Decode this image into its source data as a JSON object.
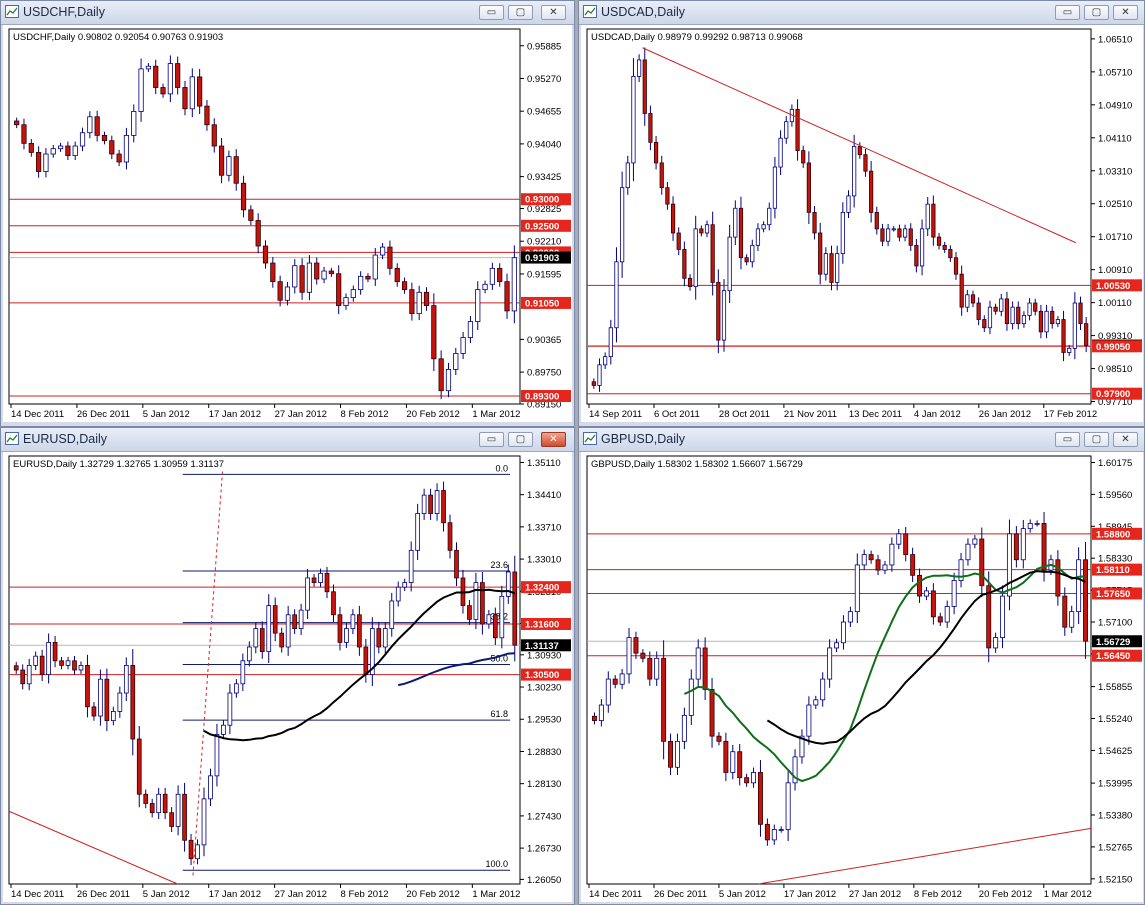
{
  "windows": [
    {
      "id": "usdchf",
      "title": "USDCHF,Daily",
      "header": "USDCHF,Daily  0.90802 0.92054 0.90763 0.91903",
      "chart_data": {
        "type": "candlestick",
        "symbol": "USDCHF",
        "timeframe": "Daily",
        "ohlc_last": {
          "open": 0.90802,
          "high": 0.92054,
          "low": 0.90763,
          "close": 0.91903
        },
        "y_ticks": [
          "0.95885",
          "0.95270",
          "0.94655",
          "0.94040",
          "0.93425",
          "0.92825",
          "0.92210",
          "0.91595",
          "0.90365",
          "0.89750",
          "0.89150"
        ],
        "ylim": [
          0.8915,
          0.962
        ],
        "x_ticks": [
          "14 Dec 2011",
          "26 Dec 2011",
          "5 Jan 2012",
          "17 Jan 2012",
          "27 Jan 2012",
          "8 Feb 2012",
          "20 Feb 2012",
          "1 Mar 2012"
        ],
        "price_labels": [
          {
            "value": 0.93,
            "text": "0.93000",
            "bg": "#e5261c"
          },
          {
            "value": 0.925,
            "text": "0.92500",
            "bg": "#e5261c"
          },
          {
            "value": 0.92,
            "text": "0.92000",
            "bg": "#e5261c"
          },
          {
            "value": 0.91903,
            "text": "0.91903",
            "bg": "#000000"
          },
          {
            "value": 0.9105,
            "text": "0.91050",
            "bg": "#e5261c"
          },
          {
            "value": 0.893,
            "text": "0.89300",
            "bg": "#e5261c"
          }
        ],
        "closes": [
          0.944,
          0.9405,
          0.9388,
          0.9352,
          0.9385,
          0.9395,
          0.94,
          0.9382,
          0.94,
          0.9425,
          0.9455,
          0.942,
          0.941,
          0.9385,
          0.937,
          0.942,
          0.9465,
          0.9545,
          0.955,
          0.951,
          0.9498,
          0.9555,
          0.951,
          0.947,
          0.953,
          0.9475,
          0.944,
          0.94,
          0.9345,
          0.938,
          0.933,
          0.928,
          0.926,
          0.9212,
          0.918,
          0.9145,
          0.911,
          0.9135,
          0.9175,
          0.9125,
          0.918,
          0.915,
          0.9165,
          0.916,
          0.91,
          0.9115,
          0.913,
          0.9155,
          0.915,
          0.9195,
          0.921,
          0.917,
          0.9145,
          0.913,
          0.9085,
          0.9125,
          0.91,
          0.9,
          0.894,
          0.898,
          0.901,
          0.904,
          0.907,
          0.913,
          0.914,
          0.917,
          0.9145,
          0.909,
          0.919
        ]
      }
    },
    {
      "id": "usdcad",
      "title": "USDCAD,Daily",
      "header": "USDCAD,Daily  0.98979 0.99292 0.98713 0.99068",
      "chart_data": {
        "type": "candlestick",
        "symbol": "USDCAD",
        "timeframe": "Daily",
        "ohlc_last": {
          "open": 0.98979,
          "high": 0.99292,
          "low": 0.98713,
          "close": 0.99068
        },
        "y_ticks": [
          "1.06510",
          "1.05710",
          "1.04910",
          "1.04110",
          "1.03310",
          "1.02510",
          "1.01710",
          "1.00910",
          "1.00110",
          "0.99310",
          "0.98510",
          "0.97710"
        ],
        "ylim": [
          0.9765,
          1.0675
        ],
        "x_ticks": [
          "14 Sep 2011",
          "6 Oct 2011",
          "28 Oct 2011",
          "21 Nov 2011",
          "13 Dec 2011",
          "4 Jan 2012",
          "26 Jan 2012",
          "17 Feb 2012"
        ],
        "price_labels": [
          {
            "value": 1.0053,
            "text": "1.00530",
            "bg": "#e5261c"
          },
          {
            "value": 0.99068,
            "text": "0.99068",
            "bg": "#000000"
          },
          {
            "value": 0.9905,
            "text": "0.99050",
            "bg": "#e5261c"
          },
          {
            "value": 0.979,
            "text": "0.97900",
            "bg": "#e5261c"
          }
        ],
        "closes": [
          0.981,
          0.986,
          0.988,
          0.995,
          1.011,
          1.029,
          1.035,
          1.056,
          1.06,
          1.047,
          1.04,
          1.035,
          1.029,
          1.025,
          1.018,
          1.014,
          1.007,
          1.005,
          1.019,
          1.018,
          1.02,
          1.006,
          0.992,
          1.004,
          1.017,
          1.024,
          1.012,
          1.011,
          1.015,
          1.019,
          1.02,
          1.024,
          1.034,
          1.041,
          1.045,
          1.048,
          1.038,
          1.035,
          1.023,
          1.018,
          1.008,
          1.013,
          1.006,
          1.013,
          1.023,
          1.027,
          1.039,
          1.037,
          1.033,
          1.023,
          1.019,
          1.016,
          1.019,
          1.019,
          1.017,
          1.019,
          1.015,
          1.01,
          1.019,
          1.025,
          1.017,
          1.015,
          1.014,
          1.012,
          1.008,
          1.0,
          1.003,
          1.001,
          0.997,
          0.995,
          1.0,
          0.999,
          1.002,
          0.996,
          1.0,
          0.996,
          0.998,
          1.001,
          0.999,
          0.994,
          0.999,
          0.996,
          0.997,
          0.989,
          0.99,
          1.001,
          0.996,
          0.9907
        ]
      }
    },
    {
      "id": "eurusd",
      "title": "EURUSD,Daily",
      "header": "EURUSD,Daily  1.32729 1.32765 1.30959 1.31137",
      "chart_data": {
        "type": "candlestick",
        "symbol": "EURUSD",
        "timeframe": "Daily",
        "ohlc_last": {
          "open": 1.32729,
          "high": 1.32765,
          "low": 1.30959,
          "close": 1.31137
        },
        "y_ticks": [
          "1.35110",
          "1.34410",
          "1.33710",
          "1.33010",
          "1.32310",
          "1.31610",
          "1.30930",
          "1.30230",
          "1.29530",
          "1.28830",
          "1.28130",
          "1.27430",
          "1.26730",
          "1.26050"
        ],
        "ylim": [
          1.2595,
          1.3525
        ],
        "x_ticks": [
          "14 Dec 2011",
          "26 Dec 2011",
          "5 Jan 2012",
          "17 Jan 2012",
          "27 Jan 2012",
          "8 Feb 2012",
          "20 Feb 2012",
          "1 Mar 2012"
        ],
        "fib_levels": [
          {
            "label": "0.0",
            "value": 1.3485
          },
          {
            "label": "23.6",
            "value": 1.3275
          },
          {
            "label": "38.2",
            "value": 1.3163
          },
          {
            "label": "50.0",
            "value": 1.3072
          },
          {
            "label": "61.8",
            "value": 1.2951
          },
          {
            "label": "100.0",
            "value": 1.2625
          }
        ],
        "price_labels": [
          {
            "value": 1.324,
            "text": "1.32400",
            "bg": "#e5261c"
          },
          {
            "value": 1.316,
            "text": "1.31600",
            "bg": "#e5261c"
          },
          {
            "value": 1.31137,
            "text": "1.31137",
            "bg": "#000000"
          },
          {
            "value": 1.305,
            "text": "1.30500",
            "bg": "#e5261c"
          }
        ],
        "closes": [
          1.306,
          1.303,
          1.307,
          1.309,
          1.305,
          1.312,
          1.308,
          1.307,
          1.308,
          1.306,
          1.307,
          1.298,
          1.296,
          1.304,
          1.295,
          1.297,
          1.301,
          1.307,
          1.291,
          1.279,
          1.277,
          1.275,
          1.279,
          1.275,
          1.272,
          1.279,
          1.269,
          1.265,
          1.268,
          1.278,
          1.283,
          1.292,
          1.294,
          1.301,
          1.303,
          1.308,
          1.311,
          1.315,
          1.31,
          1.32,
          1.314,
          1.311,
          1.318,
          1.315,
          1.319,
          1.326,
          1.325,
          1.327,
          1.323,
          1.318,
          1.312,
          1.315,
          1.318,
          1.311,
          1.305,
          1.315,
          1.311,
          1.315,
          1.321,
          1.324,
          1.325,
          1.332,
          1.34,
          1.344,
          1.34,
          1.345,
          1.338,
          1.332,
          1.326,
          1.32,
          1.317,
          1.325,
          1.316,
          1.318,
          1.313,
          1.322,
          1.3273,
          1.3114
        ]
      }
    },
    {
      "id": "gbpusd",
      "title": "GBPUSD,Daily",
      "header": "GBPUSD,Daily  1.58302 1.58302 1.56607 1.56729",
      "chart_data": {
        "type": "candlestick",
        "symbol": "GBPUSD",
        "timeframe": "Daily",
        "ohlc_last": {
          "open": 1.58302,
          "high": 1.58302,
          "low": 1.56607,
          "close": 1.56729
        },
        "y_ticks": [
          "1.60175",
          "1.59560",
          "1.58945",
          "1.58330",
          "1.57715",
          "1.57100",
          "1.56485",
          "1.55855",
          "1.55240",
          "1.54625",
          "1.53995",
          "1.53380",
          "1.52765",
          "1.52150"
        ],
        "ylim": [
          1.5205,
          1.603
        ],
        "x_ticks": [
          "14 Dec 2011",
          "26 Dec 2011",
          "5 Jan 2012",
          "17 Jan 2012",
          "27 Jan 2012",
          "8 Feb 2012",
          "20 Feb 2012",
          "1 Mar 2012"
        ],
        "price_labels": [
          {
            "value": 1.588,
            "text": "1.58800",
            "bg": "#e5261c"
          },
          {
            "value": 1.5811,
            "text": "1.58110",
            "bg": "#e5261c"
          },
          {
            "value": 1.5765,
            "text": "1.57650",
            "bg": "#e5261c"
          },
          {
            "value": 1.56729,
            "text": "1.56729",
            "bg": "#000000"
          },
          {
            "value": 1.5645,
            "text": "1.56450",
            "bg": "#e5261c"
          }
        ],
        "closes": [
          1.552,
          1.555,
          1.56,
          1.559,
          1.561,
          1.568,
          1.565,
          1.564,
          1.56,
          1.564,
          1.548,
          1.543,
          1.548,
          1.553,
          1.56,
          1.566,
          1.558,
          1.549,
          1.548,
          1.542,
          1.546,
          1.541,
          1.54,
          1.542,
          1.532,
          1.529,
          1.531,
          1.531,
          1.54,
          1.545,
          1.549,
          1.555,
          1.556,
          1.56,
          1.566,
          1.567,
          1.571,
          1.573,
          1.582,
          1.584,
          1.583,
          1.581,
          1.582,
          1.586,
          1.588,
          1.584,
          1.58,
          1.576,
          1.577,
          1.572,
          1.571,
          1.574,
          1.579,
          1.583,
          1.586,
          1.587,
          1.578,
          1.566,
          1.568,
          1.576,
          1.588,
          1.583,
          1.589,
          1.59,
          1.59,
          1.581,
          1.583,
          1.576,
          1.57,
          1.573,
          1.583,
          1.5673
        ]
      }
    }
  ],
  "buttons": {
    "minimize": "▭",
    "maximize": "▢",
    "close": "✕"
  }
}
